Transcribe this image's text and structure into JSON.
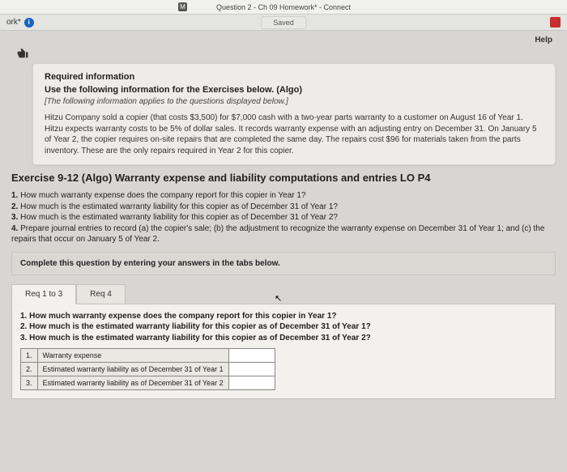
{
  "window": {
    "app_icon_letter": "M",
    "title": "Question 2 - Ch 09 Homework* - Connect"
  },
  "header": {
    "left_text": "ork*",
    "saved_label": "Saved",
    "help_label": "Help"
  },
  "info_card": {
    "heading": "Required information",
    "use_line": "Use the following information for the Exercises below. (Algo)",
    "italic_line": "[The following information applies to the questions displayed below.]",
    "body": "Hitzu Company sold a copier (that costs $3,500) for $7,000 cash with a two-year parts warranty to a customer on August 16 of Year 1. Hitzu expects warranty costs to be 5% of dollar sales. It records warranty expense with an adjusting entry on December 31. On January 5 of Year 2, the copier requires on-site repairs that are completed the same day. The repairs cost $96 for materials taken from the parts inventory. These are the only repairs required in Year 2 for this copier."
  },
  "exercise": {
    "title": "Exercise 9-12 (Algo) Warranty expense and liability computations and entries LO P4"
  },
  "questions": {
    "q1_num": "1.",
    "q1_text": " How much warranty expense does the company report for this copier in Year 1?",
    "q2_num": "2.",
    "q2_text": " How much is the estimated warranty liability for this copier as of December 31 of Year 1?",
    "q3_num": "3.",
    "q3_text": " How much is the estimated warranty liability for this copier as of December 31 of Year 2?",
    "q4_num": "4.",
    "q4_text": " Prepare journal entries to record (a) the copier's sale; (b) the adjustment to recognize the warranty expense on December 31 of Year 1; and (c) the repairs that occur on January 5 of Year 2."
  },
  "complete_line": "Complete this question by entering your answers in the tabs below.",
  "tabs": {
    "t1": "Req 1 to 3",
    "t2": "Req 4"
  },
  "panel": {
    "pq1_num": "1.",
    "pq1_text": " How much warranty expense does the company report for this copier in Year 1?",
    "pq2_num": "2.",
    "pq2_text": " How much is the estimated warranty liability for this copier as of December 31 of Year 1?",
    "pq3_num": "3.",
    "pq3_text": " How much is the estimated warranty liability for this copier as of December 31 of Year 2?"
  },
  "table": {
    "r1_num": "1.",
    "r1_label": "Warranty expense",
    "r2_num": "2.",
    "r2_label": "Estimated warranty liability as of December 31 of Year 1",
    "r3_num": "3.",
    "r3_label": "Estimated warranty liability as of December 31 of Year 2"
  }
}
